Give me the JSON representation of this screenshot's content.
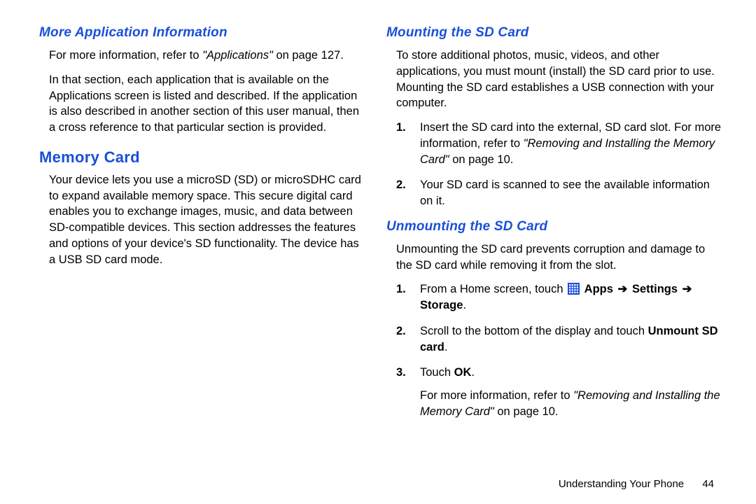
{
  "left": {
    "h1": "More Application Information",
    "p1a": "For more information, refer to ",
    "p1b": "\"Applications\"",
    "p1c": " on page 127.",
    "p2": "In that section, each application that is available on the Applications screen is listed and described. If the application is also described in another section of this user manual, then a cross reference to that particular section is provided.",
    "h2": "Memory Card",
    "p3": "Your device lets you use a microSD (SD) or microSDHC card to expand available memory space. This secure digital card enables you to exchange images, music, and data between SD-compatible devices. This section addresses the features and options of your device's SD functionality. The device has a USB SD card mode."
  },
  "right": {
    "h1": "Mounting the SD Card",
    "p1": "To store additional photos, music, videos, and other applications, you must mount (install) the SD card prior to use. Mounting the SD card establishes a USB connection with your computer.",
    "mount": {
      "n1": "1.",
      "li1a": "Insert the SD card into the external, SD card slot. For more information, refer to ",
      "li1b": "\"Removing and Installing the Memory Card\"",
      "li1c": " on page 10.",
      "n2": "2.",
      "li2": "Your SD card is scanned to see the available information on it."
    },
    "h2": "Unmounting the SD Card",
    "p2": "Unmounting the SD card prevents corruption and damage to the SD card while removing it from the slot.",
    "unmount": {
      "n1": "1.",
      "li1a": "From a Home screen, touch ",
      "apps": "Apps",
      "arrow": "➔",
      "settings": "Settings",
      "storage": "Storage",
      "period": ".",
      "n2": "2.",
      "li2a": "Scroll to the bottom of the display and touch ",
      "li2b": "Unmount SD card",
      "li2c": ".",
      "n3": "3.",
      "li3a": "Touch ",
      "li3b": "OK",
      "li3c": ".",
      "li3d": "For more information, refer to ",
      "li3e": "\"Removing and Installing the Memory Card\"",
      "li3f": " on page 10."
    }
  },
  "footer": {
    "section": "Understanding Your Phone",
    "page": "44"
  }
}
